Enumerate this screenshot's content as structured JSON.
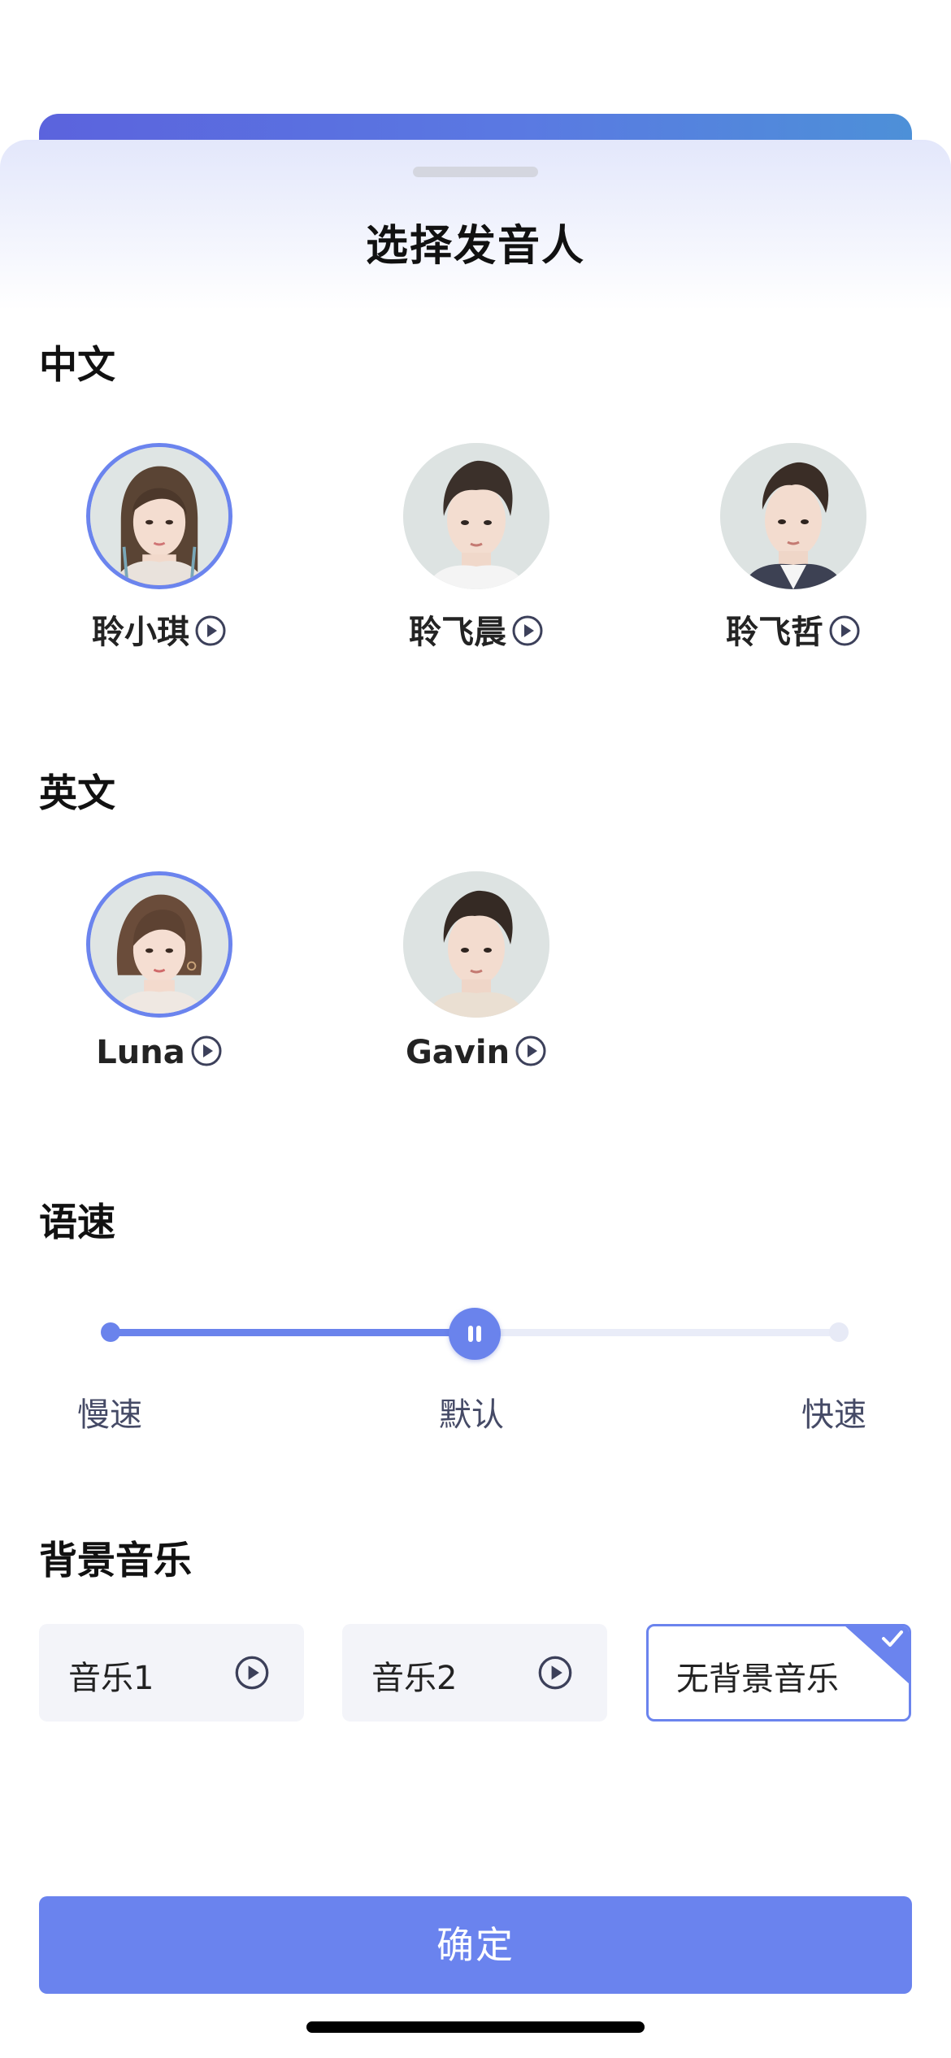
{
  "sheet": {
    "title": "选择发音人"
  },
  "sections": {
    "chinese": "中文",
    "english": "英文",
    "speed": "语速",
    "music": "背景音乐"
  },
  "voices": {
    "chinese": [
      {
        "name": "聆小琪",
        "selected": true
      },
      {
        "name": "聆飞晨",
        "selected": false
      },
      {
        "name": "聆飞哲",
        "selected": false
      }
    ],
    "english": [
      {
        "name": "Luna",
        "selected": true
      },
      {
        "name": "Gavin",
        "selected": false
      }
    ]
  },
  "speed": {
    "labels": [
      "慢速",
      "默认",
      "快速"
    ],
    "selected": "默认",
    "value_fraction": 0.5
  },
  "music": {
    "options": [
      {
        "label": "音乐1",
        "selected": false
      },
      {
        "label": "音乐2",
        "selected": false
      },
      {
        "label": "无背景音乐",
        "selected": true
      }
    ]
  },
  "confirm_label": "确定",
  "colors": {
    "accent": "#6a83ee",
    "header_gradient_start": "#5b63dd",
    "header_gradient_end": "#4d90d8",
    "card_bg": "#f3f4f9",
    "avatar_bg": "#dde3e2"
  }
}
